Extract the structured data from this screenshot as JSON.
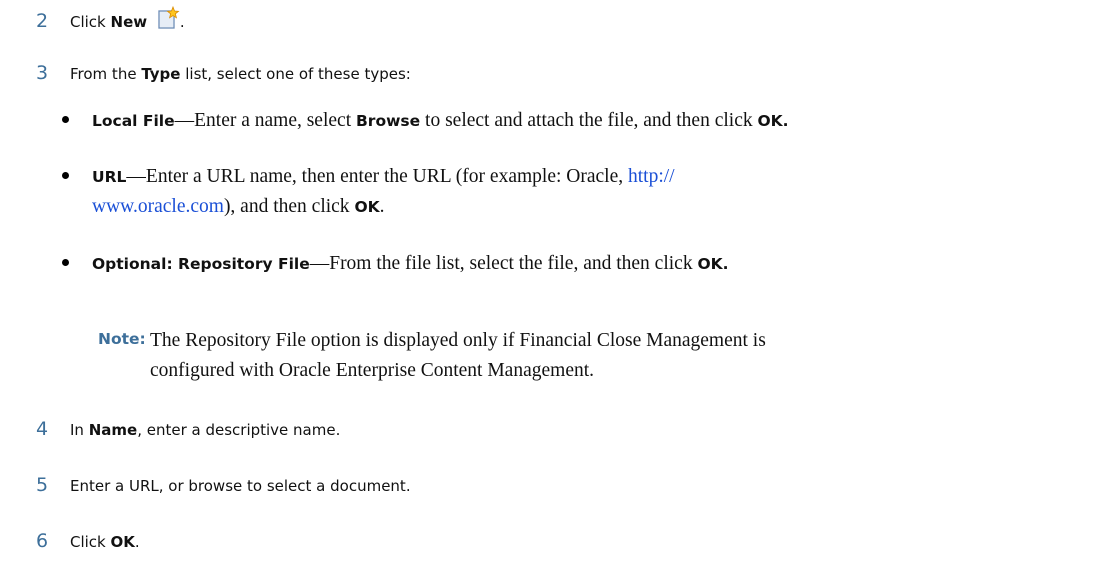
{
  "steps": [
    {
      "num": "2",
      "prefix": "Click ",
      "bold": "New",
      "suffix": ".",
      "icon": "new-document-icon"
    },
    {
      "num": "3",
      "prefix": "From the ",
      "bold": "Type",
      "suffix": " list, select one of these types:"
    },
    {
      "num": "4",
      "prefix": "In ",
      "bold": "Name",
      "suffix": ", enter a descriptive name."
    },
    {
      "num": "5",
      "text": "Enter a URL, or browse to select a document."
    },
    {
      "num": "6",
      "prefix": "Click ",
      "bold": "OK",
      "suffix": "."
    }
  ],
  "bullets": {
    "local": {
      "label": "Local File",
      "t1": "—Enter a name, select ",
      "b1": "Browse",
      "t2": " to select and attach the file, and then click ",
      "b2": "OK."
    },
    "url": {
      "label": "URL",
      "t1": "—Enter a URL name, then enter the URL (for example: Oracle, ",
      "link_line1": "http://",
      "link_line2": "www.oracle.com",
      "t2": "), and then click ",
      "b1": "OK",
      "t3": "."
    },
    "repo": {
      "label": "Optional: Repository File",
      "t1": "—From the file list, select the file, and then click ",
      "b1": "OK."
    }
  },
  "note": {
    "label": "Note:",
    "line1": "The Repository File option is displayed only if Financial Close Management is",
    "line2": "configured with Oracle Enterprise Content Management."
  },
  "colors": {
    "step_number": "#3d6f9a",
    "link": "#1a4fd6"
  }
}
